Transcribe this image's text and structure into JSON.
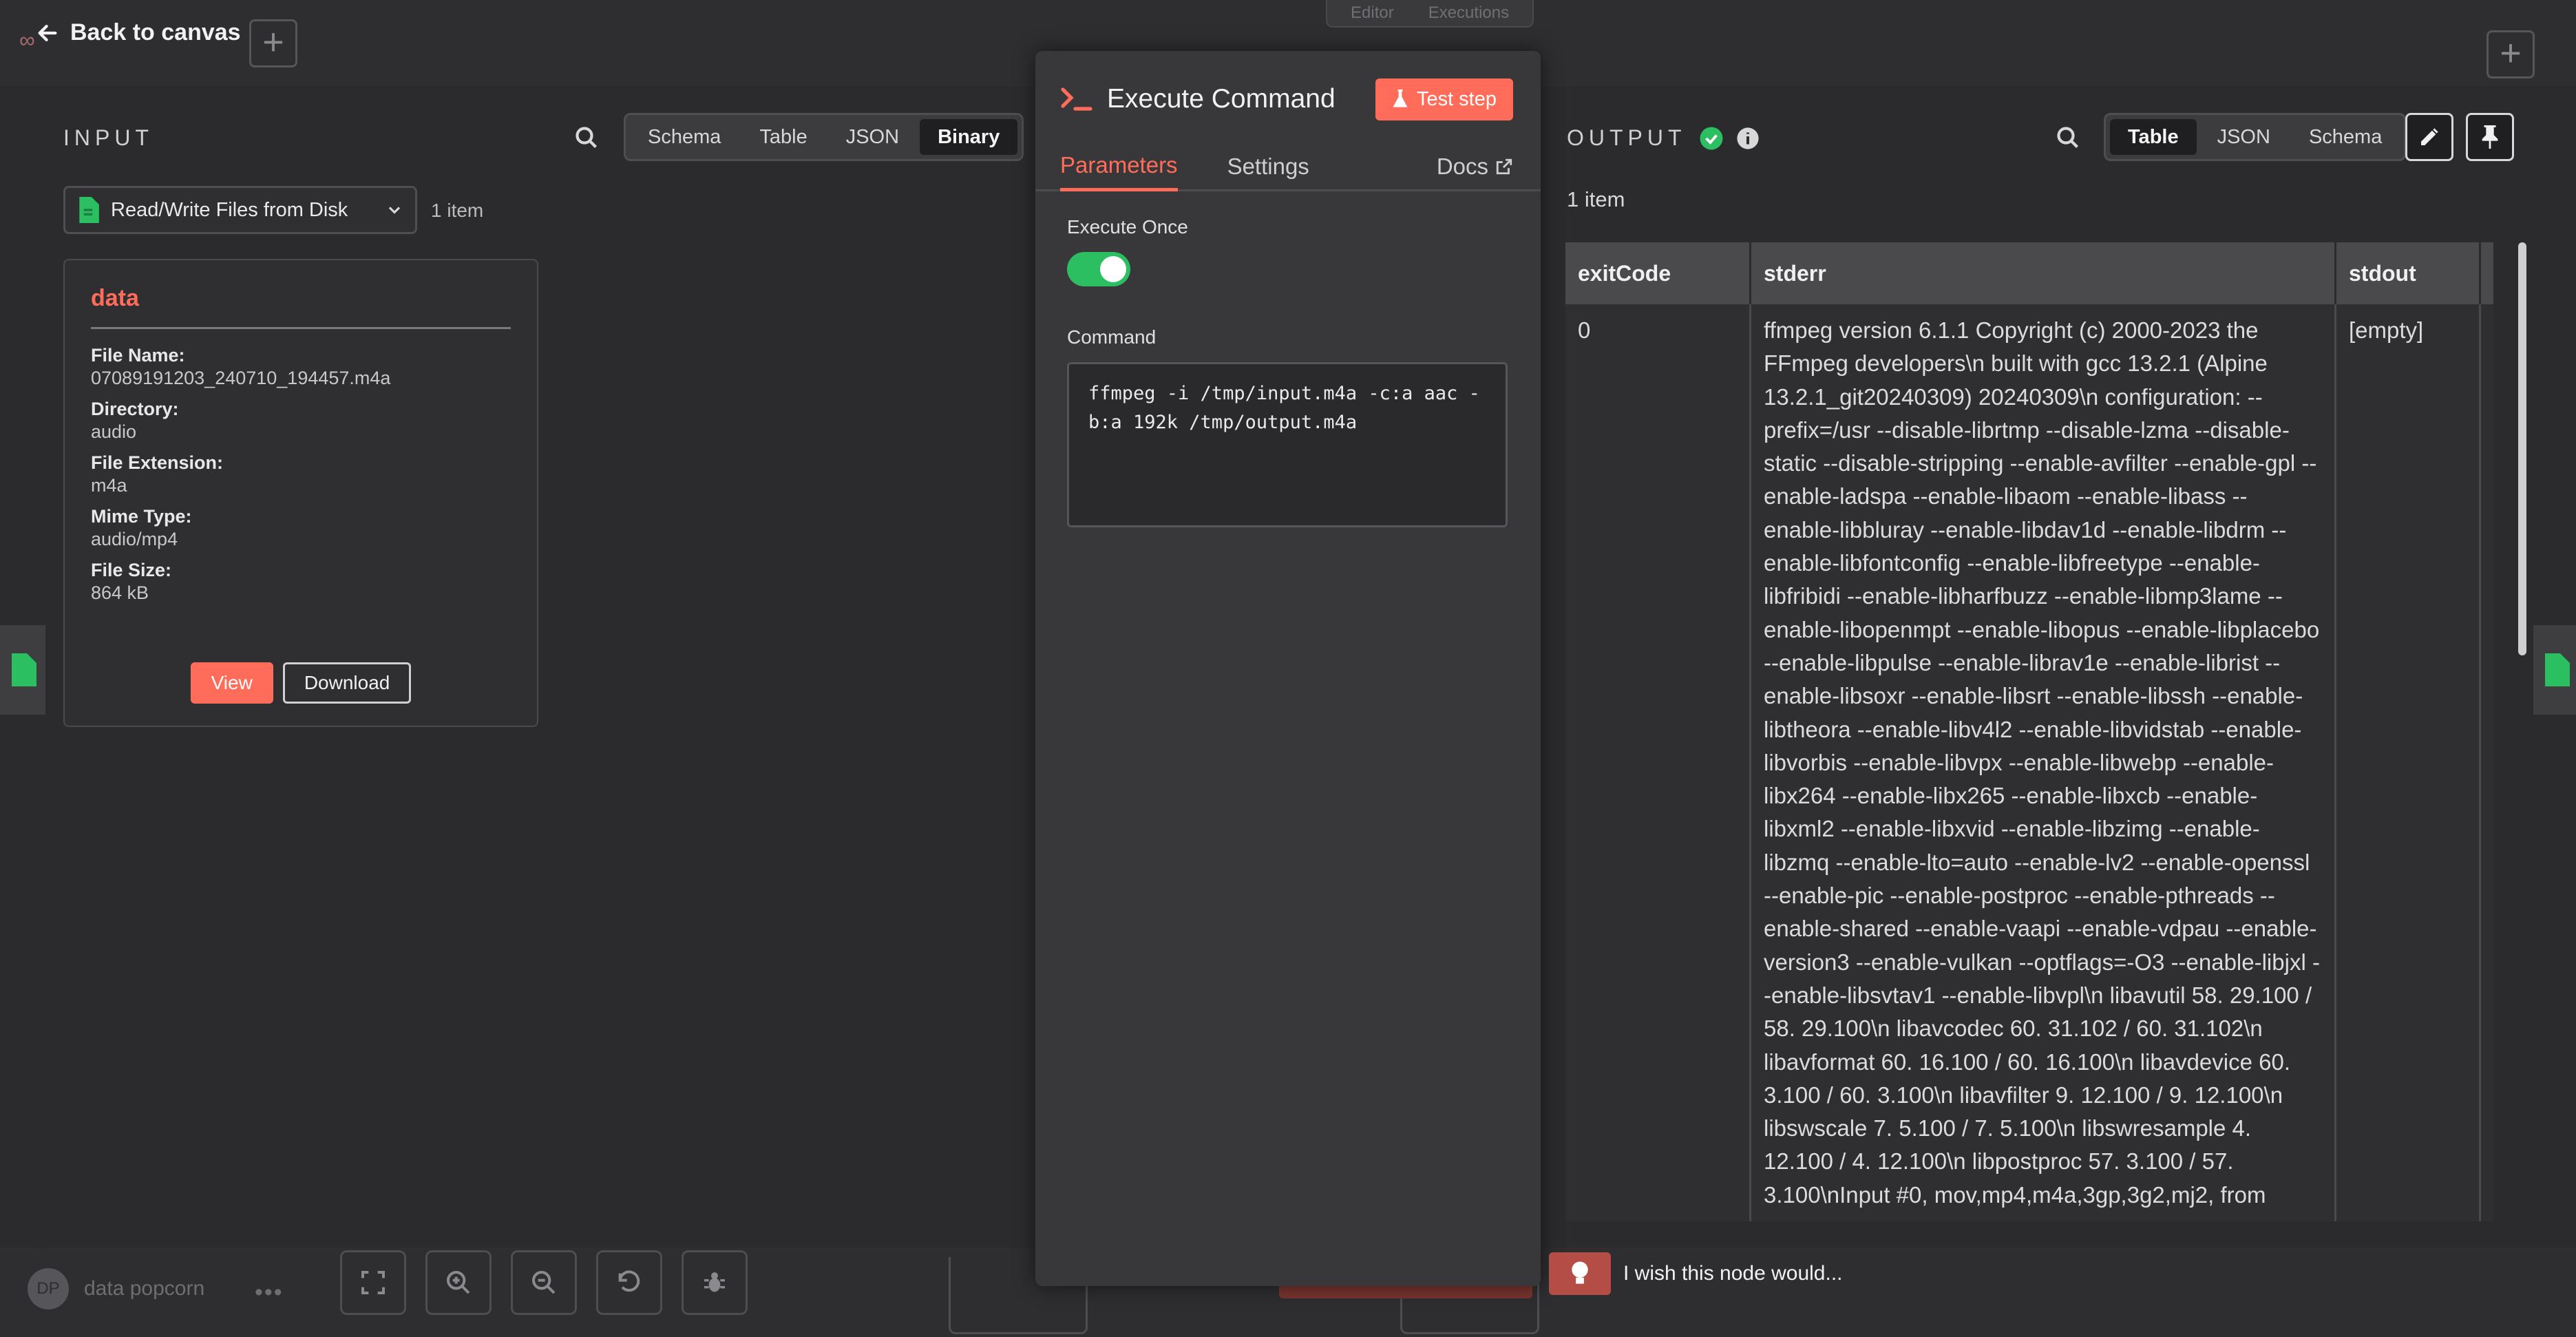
{
  "background": {
    "tabs": [
      "Editor",
      "Executions"
    ],
    "user": {
      "initials": "DP",
      "name": "data popcorn"
    }
  },
  "nav": {
    "back_label": "Back to canvas"
  },
  "input": {
    "title": "INPUT",
    "view_modes": [
      "Schema",
      "Table",
      "JSON",
      "Binary"
    ],
    "active_mode": "Binary",
    "source_node": "Read/Write Files from Disk",
    "item_count": "1 item",
    "binary": {
      "key": "data",
      "fields": [
        {
          "label": "File Name:",
          "value": "07089191203_240710_194457.m4a"
        },
        {
          "label": "Directory:",
          "value": "audio"
        },
        {
          "label": "File Extension:",
          "value": "m4a"
        },
        {
          "label": "Mime Type:",
          "value": "audio/mp4"
        },
        {
          "label": "File Size:",
          "value": "864 kB"
        }
      ],
      "view_label": "View",
      "download_label": "Download"
    }
  },
  "params": {
    "node_name": "Execute Command",
    "test_label": "Test step",
    "tabs": [
      "Parameters",
      "Settings"
    ],
    "docs_label": "Docs",
    "execute_once_label": "Execute Once",
    "execute_once": true,
    "command_label": "Command",
    "command_value": "ffmpeg -i /tmp/input.m4a -c:a aac -b:a 192k /tmp/output.m4a"
  },
  "output": {
    "title": "OUTPUT",
    "view_modes": [
      "Table",
      "JSON",
      "Schema"
    ],
    "active_mode": "Table",
    "item_count": "1 item",
    "columns": [
      "exitCode",
      "stderr",
      "stdout"
    ],
    "rows": [
      {
        "exitCode": "0",
        "stderr": "ffmpeg version 6.1.1 Copyright (c) 2000-2023 the FFmpeg developers\\n  built with gcc 13.2.1 (Alpine 13.2.1_git20240309) 20240309\\n  configuration: --prefix=/usr --disable-librtmp --disable-lzma --disable-static --disable-stripping --enable-avfilter --enable-gpl --enable-ladspa --enable-libaom --enable-libass --enable-libbluray --enable-libdav1d --enable-libdrm --enable-libfontconfig --enable-libfreetype --enable-libfribidi --enable-libharfbuzz --enable-libmp3lame --enable-libopenmpt --enable-libopus --enable-libplacebo --enable-libpulse --enable-librav1e --enable-librist --enable-libsoxr --enable-libsrt --enable-libssh --enable-libtheora --enable-libv4l2 --enable-libvidstab --enable-libvorbis --enable-libvpx --enable-libwebp --enable-libx264 --enable-libx265 --enable-libxcb --enable-libxml2 --enable-libxvid --enable-libzimg --enable-libzmq --enable-lto=auto --enable-lv2 --enable-openssl --enable-pic --enable-postproc --enable-pthreads --enable-shared --enable-vaapi --enable-vdpau --enable-version3 --enable-vulkan --optflags=-O3 --enable-libjxl --enable-libsvtav1 --enable-libvpl\\n  libavutil      58. 29.100 / 58. 29.100\\n  libavcodec     60. 31.102 / 60. 31.102\\n  libavformat    60. 16.100 / 60. 16.100\\n  libavdevice    60.  3.100 / 60.  3.100\\n  libavfilter     9. 12.100 /  9. 12.100\\n  libswscale      7.  5.100 /  7.  5.100\\n  libswresample   4. 12.100 /  4. 12.100\\n  libpostproc    57.  3.100 / 57.  3.100\\nInput #0, mov,mp4,m4a,3gp,3g2,mj2, from",
        "stdout": "[empty]"
      }
    ]
  },
  "feedback": {
    "label": "I wish this node would..."
  },
  "colors": {
    "accent": "#ff6d5a",
    "success": "#2bbf61",
    "panel": "#38383b",
    "background": "#2b2b2d"
  }
}
